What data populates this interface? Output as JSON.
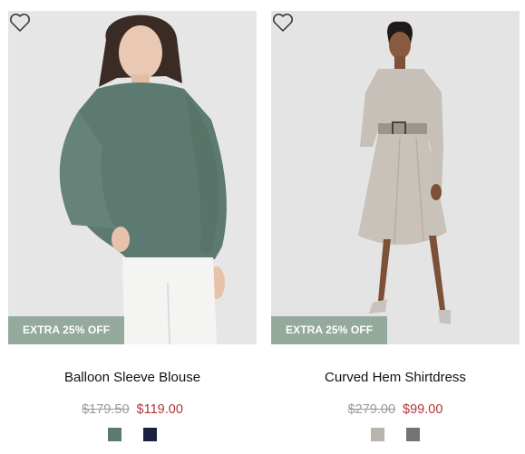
{
  "products": [
    {
      "name": "Balloon Sleeve Blouse",
      "badge": "EXTRA 25% OFF",
      "original_price": "$179.50",
      "sale_price": "$119.00",
      "swatches": [
        "#5c7a73",
        "#1b2240"
      ],
      "wishlist_icon": "heart-outline-icon"
    },
    {
      "name": "Curved Hem Shirtdress",
      "badge": "EXTRA 25% OFF",
      "original_price": "$279.00",
      "sale_price": "$99.00",
      "swatches": [
        "#b8b3ad",
        "#737373"
      ],
      "wishlist_icon": "heart-outline-icon"
    }
  ],
  "colors": {
    "badge_bg": "#94aa9c",
    "sale_price": "#b2343a",
    "original_price": "#9a9a9a"
  }
}
